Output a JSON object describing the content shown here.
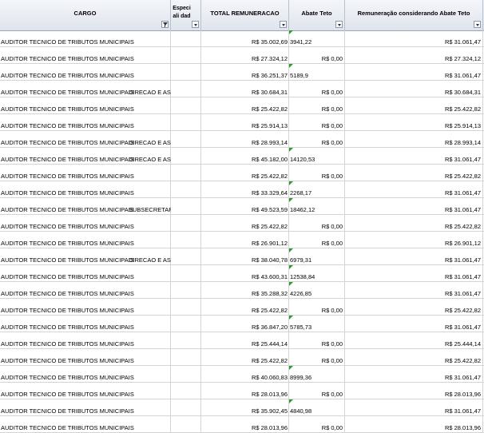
{
  "headers": {
    "cargo": "CARGO",
    "especialidade": "Especiali dad",
    "total": "TOTAL REMUNERACAO",
    "abate": "Abate Teto",
    "rem_abate": "Remuneração considerando Abate Teto"
  },
  "rows": [
    {
      "cargo": "AUDITOR TECNICO DE TRIBUTOS MUNICIPAIS",
      "org": "",
      "total": "R$ 35.002,69",
      "abate": "3941,22",
      "rem": "R$ 31.061,47"
    },
    {
      "cargo": "AUDITOR TECNICO DE TRIBUTOS MUNICIPAIS",
      "org": "",
      "total": "R$ 27.324,12",
      "abate": "R$ 0,00",
      "rem": "R$ 27.324,12"
    },
    {
      "cargo": "AUDITOR TECNICO DE TRIBUTOS MUNICIPAIS",
      "org": "",
      "total": "R$ 36.251,37",
      "abate": "5189,9",
      "rem": "R$ 31.061,47"
    },
    {
      "cargo": "AUDITOR TECNICO DE TRIBUTOS MUNICIPAIS",
      "org": "DIRECAO E ASSE",
      "total": "R$ 30.684,31",
      "abate": "R$ 0,00",
      "rem": "R$ 30.684,31"
    },
    {
      "cargo": "AUDITOR TECNICO DE TRIBUTOS MUNICIPAIS",
      "org": "",
      "total": "R$ 25.422,82",
      "abate": "R$ 0,00",
      "rem": "R$ 25.422,82"
    },
    {
      "cargo": "AUDITOR TECNICO DE TRIBUTOS MUNICIPAIS",
      "org": "",
      "total": "R$ 25.914,13",
      "abate": "R$ 0,00",
      "rem": "R$ 25.914,13"
    },
    {
      "cargo": "AUDITOR TECNICO DE TRIBUTOS MUNICIPAIS",
      "org": "DIRECAO E ASSE",
      "total": "R$ 28.993,14",
      "abate": "R$ 0,00",
      "rem": "R$ 28.993,14"
    },
    {
      "cargo": "AUDITOR TECNICO DE TRIBUTOS MUNICIPAIS",
      "org": "DIRECAO E ASSE",
      "total": "R$ 45.182,00",
      "abate": "14120,53",
      "rem": "R$ 31.061,47"
    },
    {
      "cargo": "AUDITOR TECNICO DE TRIBUTOS MUNICIPAIS",
      "org": "",
      "total": "R$ 25.422,82",
      "abate": "R$ 0,00",
      "rem": "R$ 25.422,82"
    },
    {
      "cargo": "AUDITOR TECNICO DE TRIBUTOS MUNICIPAIS",
      "org": "",
      "total": "R$ 33.329,64",
      "abate": "2268,17",
      "rem": "R$ 31.061,47"
    },
    {
      "cargo": "AUDITOR TECNICO DE TRIBUTOS MUNICIPAIS",
      "org": "SUBSECRETARIO",
      "total": "R$ 49.523,59",
      "abate": "18462,12",
      "rem": "R$ 31.061,47"
    },
    {
      "cargo": "AUDITOR TECNICO DE TRIBUTOS MUNICIPAIS",
      "org": "",
      "total": "R$ 25.422,82",
      "abate": "R$ 0,00",
      "rem": "R$ 25.422,82"
    },
    {
      "cargo": "AUDITOR TECNICO DE TRIBUTOS MUNICIPAIS",
      "org": "",
      "total": "R$ 26.901,12",
      "abate": "R$ 0,00",
      "rem": "R$ 26.901,12"
    },
    {
      "cargo": "AUDITOR TECNICO DE TRIBUTOS MUNICIPAIS",
      "org": "DIRECAO E ASSE",
      "total": "R$ 38.040,78",
      "abate": "6979,31",
      "rem": "R$ 31.061,47"
    },
    {
      "cargo": "AUDITOR TECNICO DE TRIBUTOS MUNICIPAIS",
      "org": "",
      "total": "R$ 43.600,31",
      "abate": "12538,84",
      "rem": "R$ 31.061,47"
    },
    {
      "cargo": "AUDITOR TECNICO DE TRIBUTOS MUNICIPAIS",
      "org": "",
      "total": "R$ 35.288,32",
      "abate": "4226,85",
      "rem": "R$ 31.061,47"
    },
    {
      "cargo": "AUDITOR TECNICO DE TRIBUTOS MUNICIPAIS",
      "org": "",
      "total": "R$ 25.422,82",
      "abate": "R$ 0,00",
      "rem": "R$ 25.422,82"
    },
    {
      "cargo": "AUDITOR TECNICO DE TRIBUTOS MUNICIPAIS",
      "org": "",
      "total": "R$ 36.847,20",
      "abate": "5785,73",
      "rem": "R$ 31.061,47"
    },
    {
      "cargo": "AUDITOR TECNICO DE TRIBUTOS MUNICIPAIS",
      "org": "",
      "total": "R$ 25.444,14",
      "abate": "R$ 0,00",
      "rem": "R$ 25.444,14"
    },
    {
      "cargo": "AUDITOR TECNICO DE TRIBUTOS MUNICIPAIS",
      "org": "",
      "total": "R$ 25.422,82",
      "abate": "R$ 0,00",
      "rem": "R$ 25.422,82"
    },
    {
      "cargo": "AUDITOR TECNICO DE TRIBUTOS MUNICIPAIS",
      "org": "",
      "total": "R$ 40.060,83",
      "abate": "8999,36",
      "rem": "R$ 31.061,47"
    },
    {
      "cargo": "AUDITOR TECNICO DE TRIBUTOS MUNICIPAIS",
      "org": "",
      "total": "R$ 28.013,96",
      "abate": "R$ 0,00",
      "rem": "R$ 28.013,96"
    },
    {
      "cargo": "AUDITOR TECNICO DE TRIBUTOS MUNICIPAIS",
      "org": "",
      "total": "R$ 35.902,45",
      "abate": "4840,98",
      "rem": "R$ 31.061,47"
    },
    {
      "cargo": "AUDITOR TECNICO DE TRIBUTOS MUNICIPAIS",
      "org": "",
      "total": "R$ 28.013,96",
      "abate": "R$ 0,00",
      "rem": "R$ 28.013,96"
    }
  ],
  "colors": {
    "header_bg": "#dfe4ec",
    "gridline": "#d4d4d4",
    "error_indicator": "#2e9a2e"
  },
  "icons": {
    "filter_active": "funnel-filter-icon",
    "filter": "dropdown-arrow-icon"
  }
}
